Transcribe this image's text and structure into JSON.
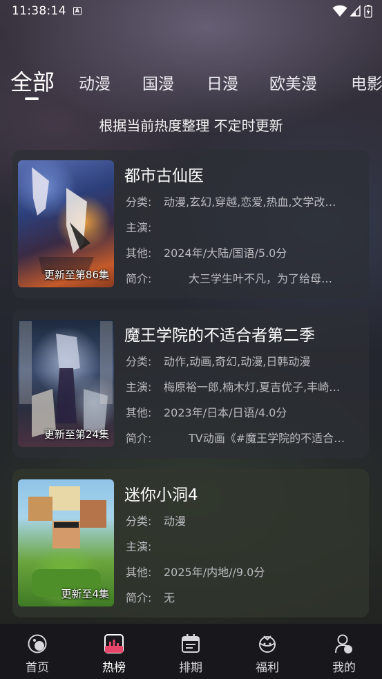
{
  "status_bar": {
    "time": "11:38:14"
  },
  "tabs": [
    {
      "label": "全部",
      "active": true
    },
    {
      "label": "动漫"
    },
    {
      "label": "国漫"
    },
    {
      "label": "日漫"
    },
    {
      "label": "欧美漫"
    },
    {
      "label": "电影"
    }
  ],
  "subtitle": "根据当前热度整理 不定时更新",
  "items": [
    {
      "title": "都市古仙医",
      "update": "更新至第86集",
      "category_label": "分类:",
      "category": "动漫,玄幻,穿越,恋爱,热血,文学改…",
      "cast_label": "主演:",
      "cast": "",
      "other_label": "其他:",
      "other": "2024年/大陆/国语/5.0分",
      "intro_label": "简介:",
      "intro": "大三学生叶不凡，为了给母…"
    },
    {
      "title": "魔王学院的不适合者第二季",
      "update": "更新至第24集",
      "category_label": "分类:",
      "category": "动作,动画,奇幻,动漫,日韩动漫",
      "cast_label": "主演:",
      "cast": "梅原裕一郎,楠木灯,夏吉优子,丰崎…",
      "other_label": "其他:",
      "other": "2023年/日本/日语/4.0分",
      "intro_label": "简介:",
      "intro": "TV动画《#魔王学院的不适合…"
    },
    {
      "title": "迷你小洞4",
      "update": "更新至4集",
      "category_label": "分类:",
      "category": "动漫",
      "cast_label": "主演:",
      "cast": "",
      "other_label": "其他:",
      "other": "2025年/内地//9.0分",
      "intro_label": "简介:",
      "intro": "无"
    }
  ],
  "nav": [
    {
      "label": "首页",
      "icon": "home-icon"
    },
    {
      "label": "热榜",
      "icon": "chart-icon",
      "active": true
    },
    {
      "label": "排期",
      "icon": "calendar-icon"
    },
    {
      "label": "福利",
      "icon": "gift-icon"
    },
    {
      "label": "我的",
      "icon": "profile-icon"
    }
  ],
  "colors": {
    "accent": "#e8456a",
    "text_secondary": "#b9bbc0"
  }
}
